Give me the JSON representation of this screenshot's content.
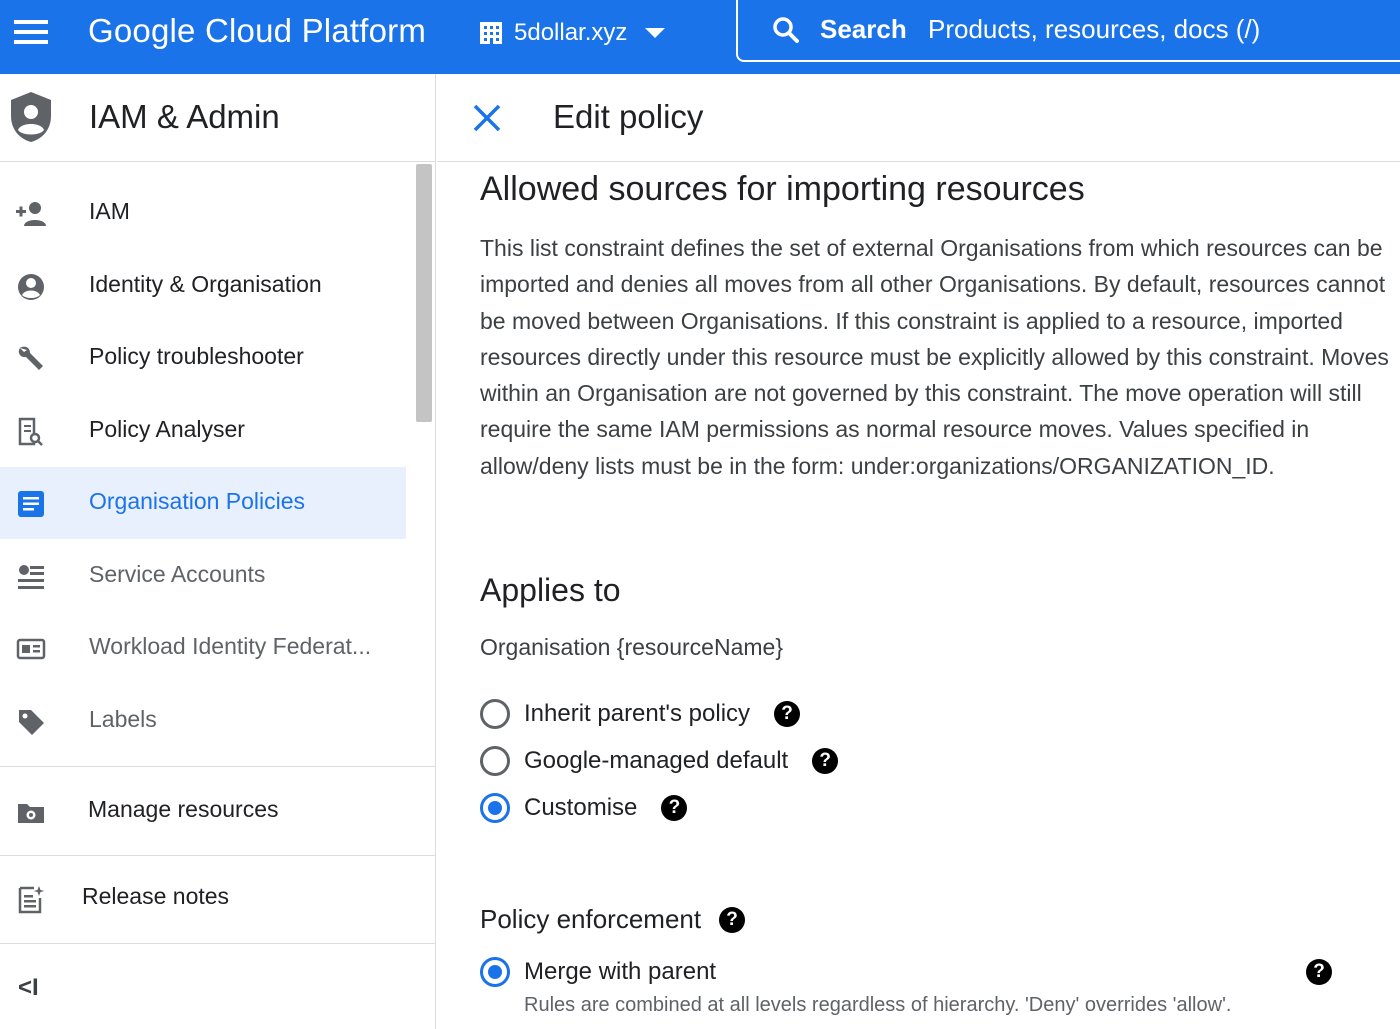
{
  "topbar": {
    "app_title": "Google Cloud Platform",
    "project_name": "5dollar.xyz",
    "search_label": "Search",
    "search_placeholder": "Products, resources, docs (/)",
    "brand_color": "#1a73e8"
  },
  "sidebar": {
    "title": "IAM & Admin",
    "items": [
      {
        "label": "IAM",
        "icon": "person-add-icon"
      },
      {
        "label": "Identity & Organisation",
        "icon": "account-circle-icon"
      },
      {
        "label": "Policy troubleshooter",
        "icon": "wrench-icon"
      },
      {
        "label": "Policy Analyser",
        "icon": "doc-search-icon"
      },
      {
        "label": "Organisation Policies",
        "icon": "list-doc-icon",
        "active": true
      },
      {
        "label": "Service Accounts",
        "icon": "service-account-icon"
      },
      {
        "label": "Workload Identity Federat...",
        "icon": "id-card-icon"
      },
      {
        "label": "Labels",
        "icon": "tag-icon"
      }
    ],
    "manage_resources": "Manage resources",
    "release_notes": "Release notes",
    "collapse": "<I"
  },
  "panel": {
    "title": "Edit policy",
    "constraint_title": "Allowed sources for importing resources",
    "description": "This list constraint defines the set of external Organisations from which resources can be imported and denies all moves from all other Organisations. By default, resources cannot be moved between Organisations. If this constraint is applied to a resource, imported resources directly under this resource must be explicitly allowed by this constraint. Moves within an Organisation are not governed by this constraint. The move operation will still require the same IAM permissions as normal resource moves. Values specified in allow/deny lists must be in the form: under:organizations/ORGANIZATION_ID.",
    "applies_to_heading": "Applies to",
    "resource": "Organisation {resourceName}",
    "options": [
      {
        "label": "Inherit parent's policy",
        "checked": false
      },
      {
        "label": "Google-managed default",
        "checked": false
      },
      {
        "label": "Customise",
        "checked": true
      }
    ],
    "enforcement_heading": "Policy enforcement",
    "enforcement_option": {
      "label": "Merge with parent",
      "checked": true
    },
    "enforcement_desc": "Rules are combined at all levels regardless of hierarchy. 'Deny' overrides 'allow'.",
    "help_glyph": "?"
  }
}
